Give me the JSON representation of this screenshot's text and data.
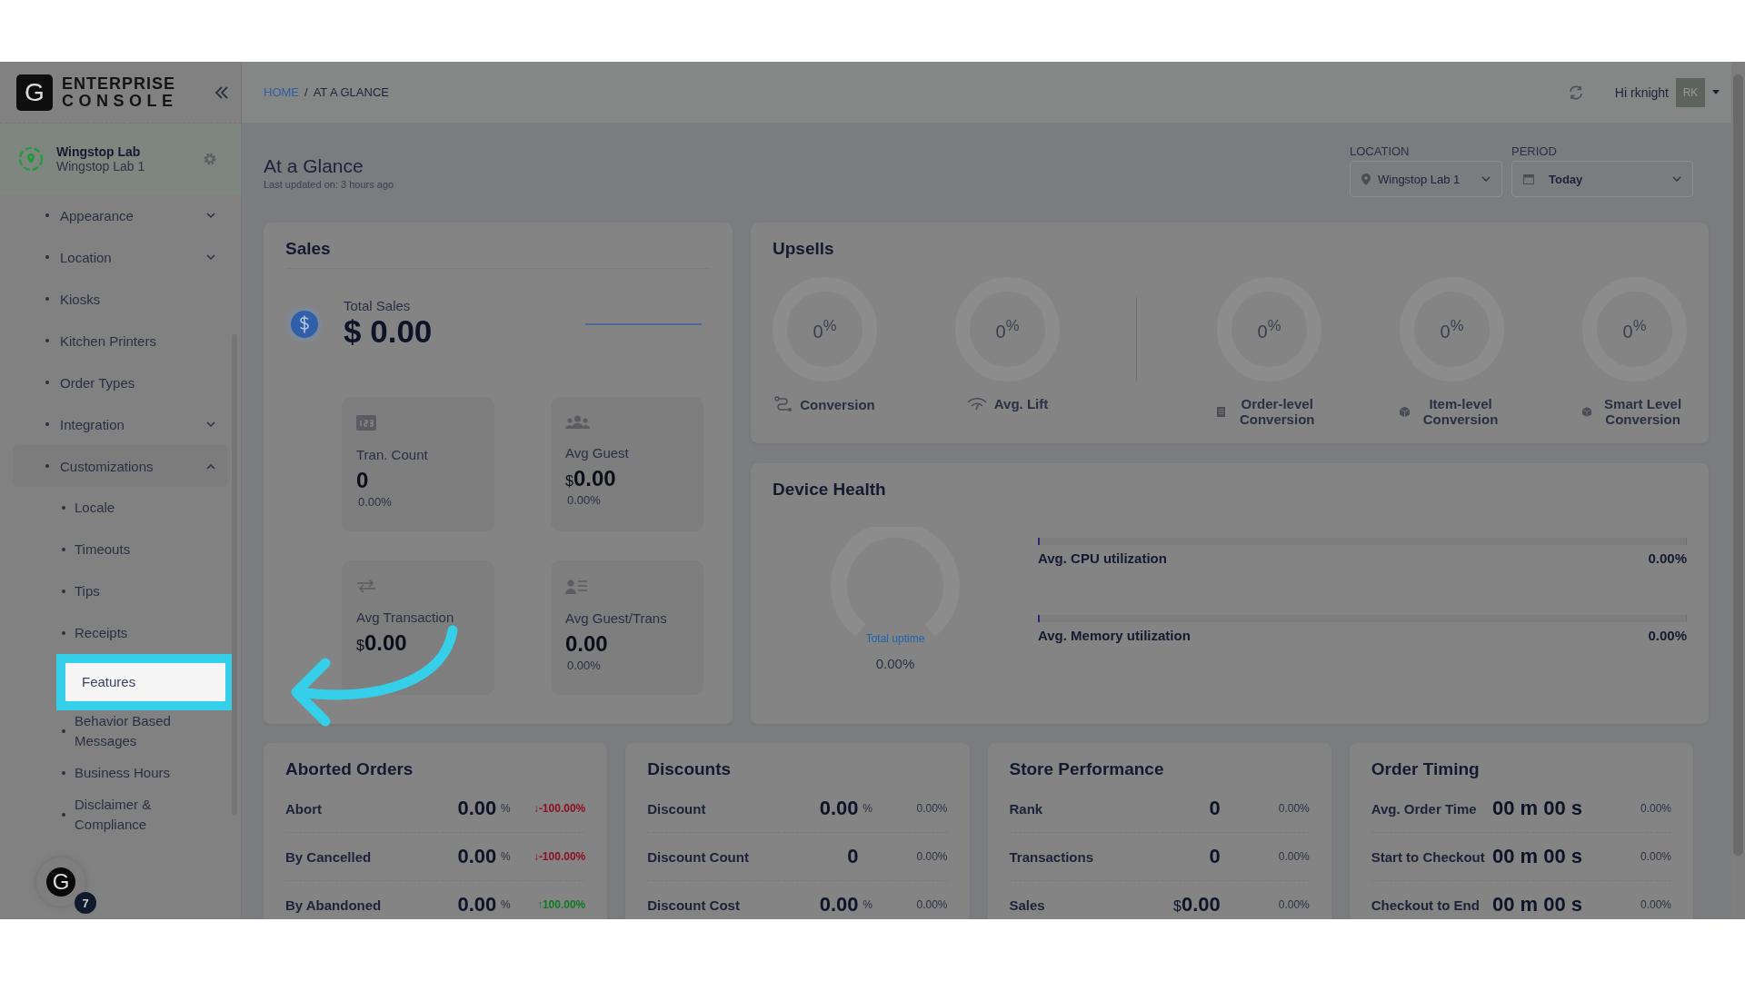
{
  "brand": {
    "mark": "G",
    "line1": "ENTERPRISE",
    "line2": "CONSOLE"
  },
  "store": {
    "name": "Wingstop Lab",
    "sub": "Wingstop Lab 1"
  },
  "sidebar": {
    "items": [
      {
        "label": "Appearance",
        "kind": "group",
        "expanded": false
      },
      {
        "label": "Location",
        "kind": "group",
        "expanded": false
      },
      {
        "label": "Kiosks",
        "kind": "link"
      },
      {
        "label": "Kitchen Printers",
        "kind": "link"
      },
      {
        "label": "Order Types",
        "kind": "link"
      },
      {
        "label": "Integration",
        "kind": "group",
        "expanded": false
      },
      {
        "label": "Customizations",
        "kind": "group",
        "expanded": true,
        "children": [
          {
            "label": "Locale",
            "selected": false
          },
          {
            "label": "Timeouts",
            "selected": false
          },
          {
            "label": "Tips",
            "selected": false
          },
          {
            "label": "Receipts",
            "selected": false
          },
          {
            "label": "Features",
            "selected": true
          },
          {
            "label": "Behavior Based Messages",
            "selected": false
          },
          {
            "label": "Business Hours",
            "selected": false
          },
          {
            "label": "Disclaimer & Compliance",
            "selected": false
          }
        ]
      }
    ]
  },
  "help_widget": {
    "letter": "G",
    "badge": "7"
  },
  "breadcrumb": {
    "items": [
      {
        "label": "HOME",
        "kind": "link"
      },
      {
        "label": "AT A GLANCE",
        "kind": "current"
      }
    ],
    "separator": "/"
  },
  "user": {
    "greeting": "Hi rknight",
    "initials": "RK"
  },
  "page": {
    "title": "At a Glance",
    "updated": "Last updated on: 3 hours ago"
  },
  "filters": [
    {
      "label": "LOCATION",
      "value": "Wingstop Lab 1",
      "kind": "location"
    },
    {
      "label": "PERIOD",
      "value": "Today",
      "kind": "date"
    }
  ],
  "sales": {
    "title": "Sales",
    "total_label": "Total Sales",
    "total_value": "$ 0.00",
    "tiles": [
      {
        "kind": "count",
        "label": "Tran. Count",
        "value": "0",
        "change": "0.00%"
      },
      {
        "kind": "guests",
        "label": "Avg Guest",
        "currency": "$",
        "value": "0.00",
        "change": "0.00%"
      },
      {
        "kind": "transfer",
        "label": "Avg Transaction",
        "currency": "$",
        "value": "0.00"
      },
      {
        "kind": "guest-list",
        "label": "Avg Guest/Trans",
        "value": "0.00",
        "change": "0.00%"
      }
    ]
  },
  "upsells": {
    "title": "Upsells",
    "groups": [
      [
        {
          "label": "Conversion",
          "value": "0$^{%}$",
          "kind": "route"
        },
        {
          "label": "Avg. Lift",
          "value": "0$^{%}$",
          "kind": "signal"
        }
      ],
      [
        {
          "label": "Order-level Conversion",
          "value": "0$^{%}$",
          "kind": "list"
        },
        {
          "label": "Item-level Conversion",
          "value": "0$^{%}$",
          "kind": "box"
        },
        {
          "label": "Smart Level Conversion",
          "value": "0$^{%}$",
          "kind": "box"
        }
      ]
    ]
  },
  "device_health": {
    "title": "Device Health",
    "uptime_label": "Total uptime",
    "uptime_value": "0.00%",
    "meters": [
      {
        "label": "Avg. CPU utilization",
        "reading": "0.00%",
        "level": 0
      },
      {
        "label": "Avg. Memory utilization",
        "reading": "0.00%",
        "level": 0
      }
    ]
  },
  "panels": [
    {
      "title": "Aborted Orders",
      "rows": [
        {
          "label": "Abort",
          "value": "0.00",
          "unit": "%",
          "arrow": "↓",
          "change": "-100.00%",
          "kind": "down"
        },
        {
          "label": "By Cancelled",
          "value": "0.00",
          "unit": "%",
          "arrow": "↓",
          "change": "-100.00%",
          "kind": "down"
        },
        {
          "label": "By Abandoned",
          "value": "0.00",
          "unit": "%",
          "arrow": "↑",
          "change": "100.00%",
          "kind": "up"
        }
      ]
    },
    {
      "title": "Discounts",
      "rows": [
        {
          "label": "Discount",
          "value": "0.00",
          "unit": "%",
          "change": "0.00%",
          "kind": "flat"
        },
        {
          "label": "Discount Count",
          "value": "0",
          "change": "0.00%",
          "kind": "flat"
        },
        {
          "label": "Discount Cost",
          "value": "0.00",
          "unit": "%",
          "change": "0.00%",
          "kind": "flat"
        }
      ]
    },
    {
      "title": "Store Performance",
      "rows": [
        {
          "label": "Rank",
          "value": "0",
          "change": "0.00%",
          "kind": "flat"
        },
        {
          "label": "Transactions",
          "value": "0",
          "change": "0.00%",
          "kind": "flat"
        },
        {
          "label": "Sales",
          "prefix": "$",
          "value": "0.00",
          "change": "0.00%",
          "kind": "flat"
        }
      ]
    },
    {
      "title": "Order Timing",
      "rows": [
        {
          "label": "Avg. Order Time",
          "value": "00 m 00 s",
          "change": "0.00%",
          "kind": "flat"
        },
        {
          "label": "Start to Checkout",
          "value": "00 m 00 s",
          "change": "0.00%",
          "kind": "flat"
        },
        {
          "label": "Checkout to End",
          "value": "00 m 00 s",
          "change": "0.00%",
          "kind": "flat"
        }
      ]
    }
  ]
}
